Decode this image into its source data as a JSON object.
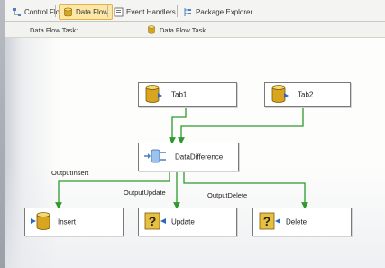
{
  "tabs": [
    {
      "label": "Control Flow",
      "icon": "control-flow-icon",
      "active": false
    },
    {
      "label": "Data Flow",
      "icon": "data-flow-icon",
      "active": true
    },
    {
      "label": "Event Handlers",
      "icon": "event-handlers-icon",
      "active": false
    },
    {
      "label": "Package Explorer",
      "icon": "package-explorer-icon",
      "active": false
    }
  ],
  "task_selector": {
    "label": "Data Flow Task:",
    "value": "Data Flow Task"
  },
  "components": {
    "tab1": {
      "label": "Tab1",
      "icon": "database-source-icon"
    },
    "tab2": {
      "label": "Tab2",
      "icon": "database-source-icon"
    },
    "data_difference": {
      "label": "DataDifference",
      "icon": "transform-icon"
    },
    "insert": {
      "label": "Insert",
      "icon": "database-destination-icon"
    },
    "update": {
      "label": "Update",
      "icon": "oledb-command-icon"
    },
    "delete": {
      "label": "Delete",
      "icon": "oledb-command-icon"
    }
  },
  "paths": {
    "output_insert": "OutputInsert",
    "output_update": "OutputUpdate",
    "output_delete": "OutputDelete"
  },
  "colors": {
    "path_green": "#2e9a2e",
    "active_tab": "#fde7a6",
    "database_gold": "#d9a520"
  }
}
